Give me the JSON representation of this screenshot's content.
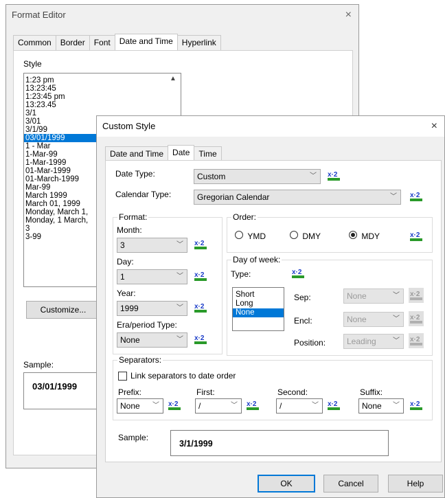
{
  "format_editor": {
    "title": "Format Editor",
    "tabs": [
      "Common",
      "Border",
      "Font",
      "Date and Time",
      "Hyperlink"
    ],
    "style_label": "Style",
    "style_items": [
      "1:23 pm",
      "13:23:45",
      "1:23:45 pm",
      "13:23.45",
      "3/1",
      "3/01",
      "3/1/99",
      "03/01/1999",
      "1 - Mar",
      "1-Mar-99",
      "1-Mar-1999",
      "01-Mar-1999",
      "01-March-1999",
      "Mar-99",
      "March 1999",
      "March 01, 1999",
      "Monday, March 1,",
      "Monday, 1 March,",
      "3",
      "3-99"
    ],
    "selected_style": "03/01/1999",
    "customize_label": "Customize...",
    "sample_label": "Sample:",
    "sample_value": "03/01/1999"
  },
  "custom_style": {
    "title": "Custom Style",
    "tabs": [
      "Date and Time",
      "Date",
      "Time"
    ],
    "active_tab": "Date",
    "date_type_label": "Date Type:",
    "date_type_value": "Custom",
    "calendar_type_label": "Calendar Type:",
    "calendar_type_value": "Gregorian Calendar",
    "format_label": "Format:",
    "month_label": "Month:",
    "month_value": "3",
    "day_label": "Day:",
    "day_value": "1",
    "year_label": "Year:",
    "year_value": "1999",
    "era_label": "Era/period Type:",
    "era_value": "None",
    "order_label": "Order:",
    "order_options": [
      "YMD",
      "DMY",
      "MDY"
    ],
    "order_selected": "MDY",
    "dow_label": "Day of week:",
    "type_label": "Type:",
    "dow_types": [
      "Short",
      "Long",
      "None"
    ],
    "dow_selected": "None",
    "sep_label": "Sep:",
    "sep_value": "None",
    "encl_label": "Encl:",
    "encl_value": "None",
    "position_label": "Position:",
    "position_value": "Leading",
    "separators_label": "Separators:",
    "link_label": "Link separators to date order",
    "prefix_label": "Prefix:",
    "prefix_value": "None",
    "first_label": "First:",
    "first_value": "/",
    "second_label": "Second:",
    "second_value": "/",
    "suffix_label": "Suffix:",
    "suffix_value": "None",
    "sample_label": "Sample:",
    "sample_value": "3/1/1999",
    "ok_label": "OK",
    "cancel_label": "Cancel",
    "help_label": "Help",
    "x2_text": "x·2",
    "close_glyph": "×"
  }
}
